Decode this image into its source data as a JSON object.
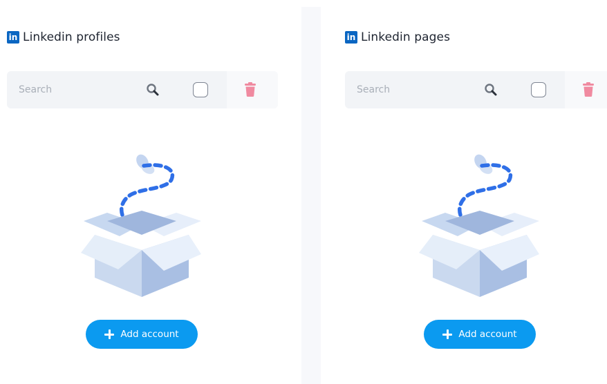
{
  "panels": [
    {
      "title": "Linkedin profiles",
      "logo_text": "in",
      "search": {
        "placeholder": "Search",
        "value": ""
      },
      "add_button_label": "Add account"
    },
    {
      "title": "Linkedin pages",
      "logo_text": "in",
      "search": {
        "placeholder": "Search",
        "value": ""
      },
      "add_button_label": "Add account"
    }
  ],
  "icons": {
    "search": "search-icon",
    "delete": "trash-icon",
    "empty": "empty-box-illustration",
    "add": "plus-icon",
    "brand": "linkedin-logo-icon"
  },
  "colors": {
    "linkedin_blue": "#0a66c2",
    "primary_button": "#0b9af0",
    "trash_pink": "#f08aa0",
    "search_bar_bg": "#f2f4f7"
  }
}
